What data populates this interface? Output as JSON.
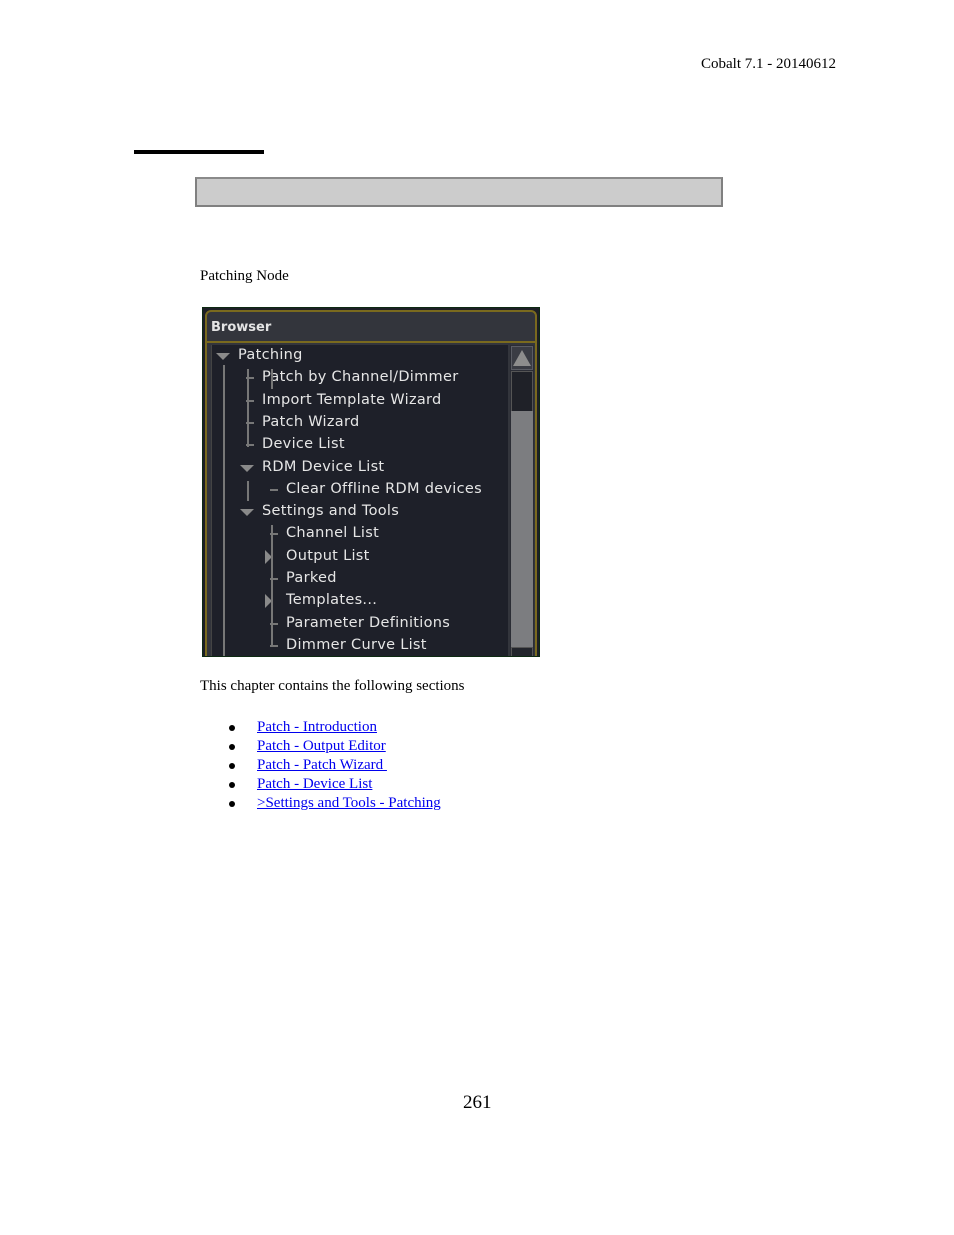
{
  "header": {
    "doc_version": "Cobalt 7.1 - 20140612"
  },
  "figure": {
    "caption": "Patching Node",
    "panel_title": "Browser",
    "tree": [
      {
        "label": "Patching",
        "level": 0,
        "expander": "expanded"
      },
      {
        "label": "Patch by Channel/Dimmer",
        "level": 1,
        "expander": "none"
      },
      {
        "label": "Import Template Wizard",
        "level": 1,
        "expander": "none"
      },
      {
        "label": "Patch Wizard",
        "level": 1,
        "expander": "none"
      },
      {
        "label": "Device List",
        "level": 1,
        "expander": "none"
      },
      {
        "label": "RDM Device List",
        "level": 1,
        "expander": "expanded"
      },
      {
        "label": "Clear Offline RDM devices",
        "level": 2,
        "expander": "none"
      },
      {
        "label": "Settings and Tools",
        "level": 1,
        "expander": "expanded"
      },
      {
        "label": "Channel List",
        "level": 2,
        "expander": "none"
      },
      {
        "label": "Output List",
        "level": 2,
        "expander": "collapsed"
      },
      {
        "label": "Parked",
        "level": 2,
        "expander": "none"
      },
      {
        "label": "Templates...",
        "level": 2,
        "expander": "collapsed"
      },
      {
        "label": "Parameter Definitions",
        "level": 2,
        "expander": "none"
      },
      {
        "label": "Dimmer Curve List",
        "level": 2,
        "expander": "none"
      }
    ],
    "scrollbar_icon": "scroll-up-arrow-icon"
  },
  "body": {
    "intro": "This chapter contains the following sections",
    "links": [
      "Patch - Introduction",
      "Patch - Output Editor",
      "Patch - Patch Wizard ",
      "Patch - Device List",
      ">Settings and Tools - Patching"
    ]
  },
  "footer": {
    "page_number": "261"
  },
  "colors": {
    "link": "#0000ee",
    "panel_border": "#7a6a1e",
    "panel_bg": "#1e2029"
  }
}
